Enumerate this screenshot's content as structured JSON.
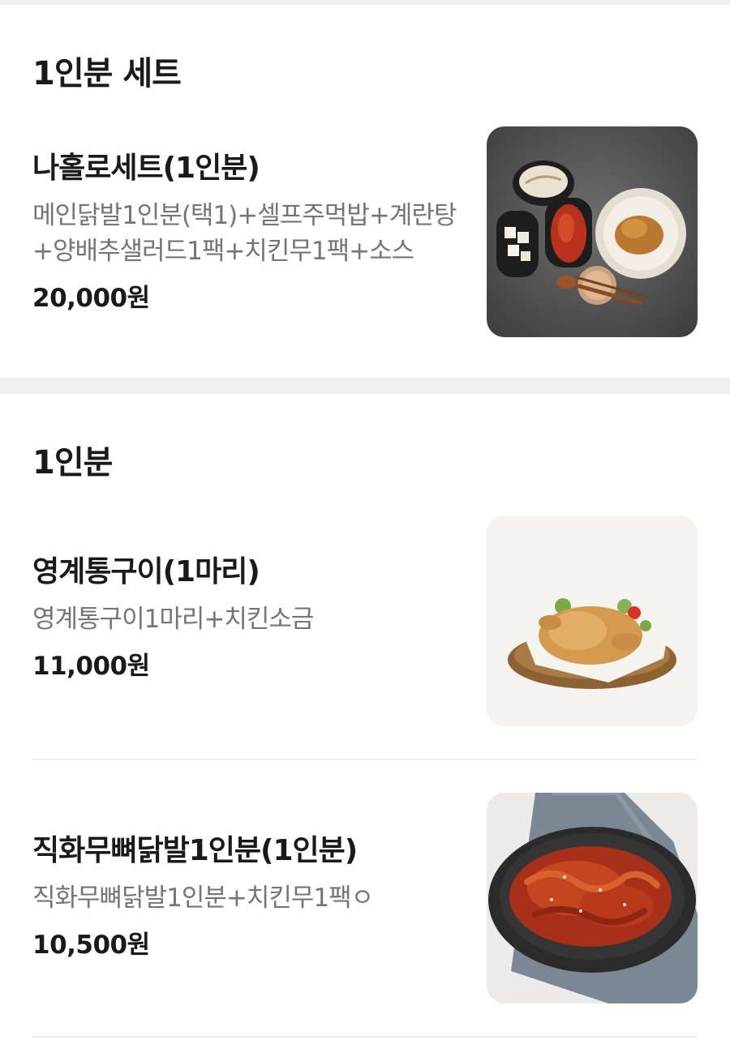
{
  "sections": [
    {
      "title": "1인분 세트",
      "items": [
        {
          "name": "나홀로세트(1인분)",
          "description": "메인닭발1인분(택1)+셀프주먹밥+계란탕+양배추샐러드1팩+치킨무1팩+소스",
          "price": "20,000원",
          "image_icon": "chicken-set-photo"
        }
      ]
    },
    {
      "title": "1인분",
      "items": [
        {
          "name": "영계통구이(1마리)",
          "description": "영계통구이1마리+치킨소금",
          "price": "11,000원",
          "image_icon": "roast-chicken-photo"
        },
        {
          "name": "직화무뼈닭발1인분(1인분)",
          "description": "직화무뼈닭발1인분+치킨무1팩ㅇ",
          "price": "10,500원",
          "image_icon": "spicy-chicken-feet-photo"
        }
      ]
    }
  ]
}
